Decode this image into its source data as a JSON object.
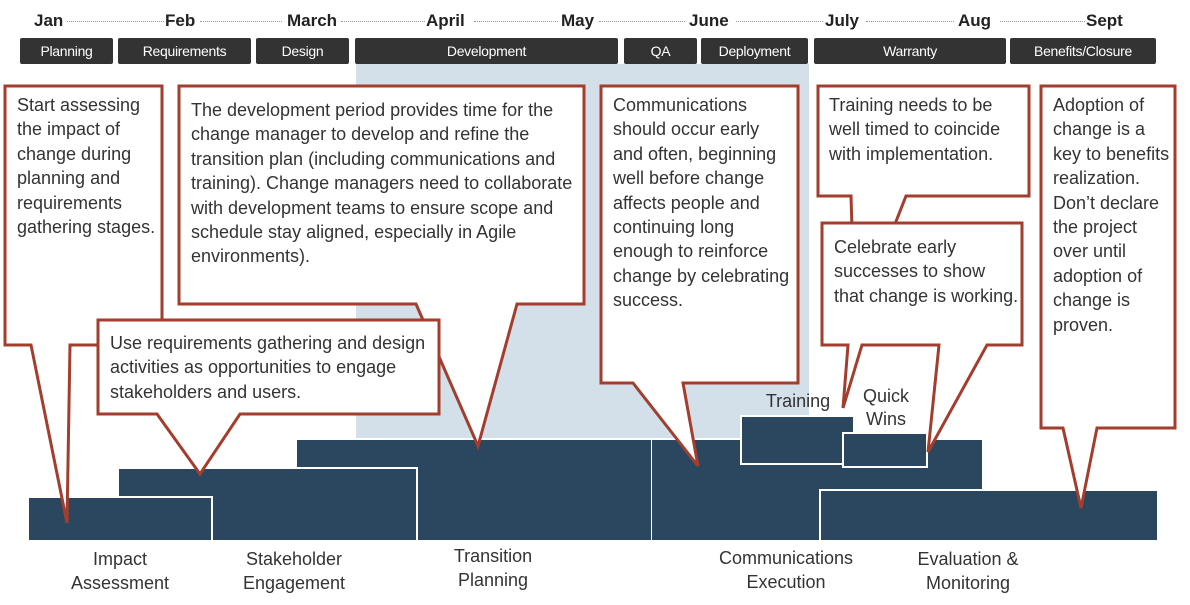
{
  "timeline": {
    "months": [
      "Jan",
      "Feb",
      "March",
      "April",
      "May",
      "June",
      "July",
      "Aug",
      "Sept"
    ],
    "phases": [
      "Planning",
      "Requirements",
      "Design",
      "Development",
      "QA",
      "Deployment",
      "Warranty",
      "Benefits/Closure"
    ]
  },
  "workstreams": [
    {
      "label_line1": "Impact",
      "label_line2": "Assessment"
    },
    {
      "label_line1": "Stakeholder",
      "label_line2": "Engagement"
    },
    {
      "label_line1": "Transition",
      "label_line2": "Planning"
    },
    {
      "label_line1": "Communications",
      "label_line2": "Execution"
    },
    {
      "label_line1": "Training"
    },
    {
      "label_line1": "Quick",
      "label_line2": "Wins"
    },
    {
      "label_line1": "Evaluation &",
      "label_line2": "Monitoring"
    }
  ],
  "callouts": [
    {
      "text": "Start assessing the impact of change during planning and requirements gathering stages."
    },
    {
      "text": "Use requirements gathering and design activities as opportunities to engage stakeholders and users."
    },
    {
      "text": "The development period provides time for the change manager to develop and refine the transition plan (including communications and training). Change managers need to collaborate with development teams to ensure scope and schedule stay aligned, especially in Agile environments)."
    },
    {
      "text": "Communications should occur early and often, beginning well before change affects people and continuing long enough to reinforce change by celebrating success."
    },
    {
      "text": "Training needs to be well timed to coincide with implementation."
    },
    {
      "text": "Celebrate early successes to show that change is working."
    },
    {
      "text": "Adoption of change is a key to benefits realization. Don’t declare the project over until adoption of change is proven."
    }
  ],
  "colors": {
    "bar": "#2b475f",
    "phase": "#333333",
    "callout_border": "#a33e2e",
    "highlight": "#d3dfe9"
  }
}
